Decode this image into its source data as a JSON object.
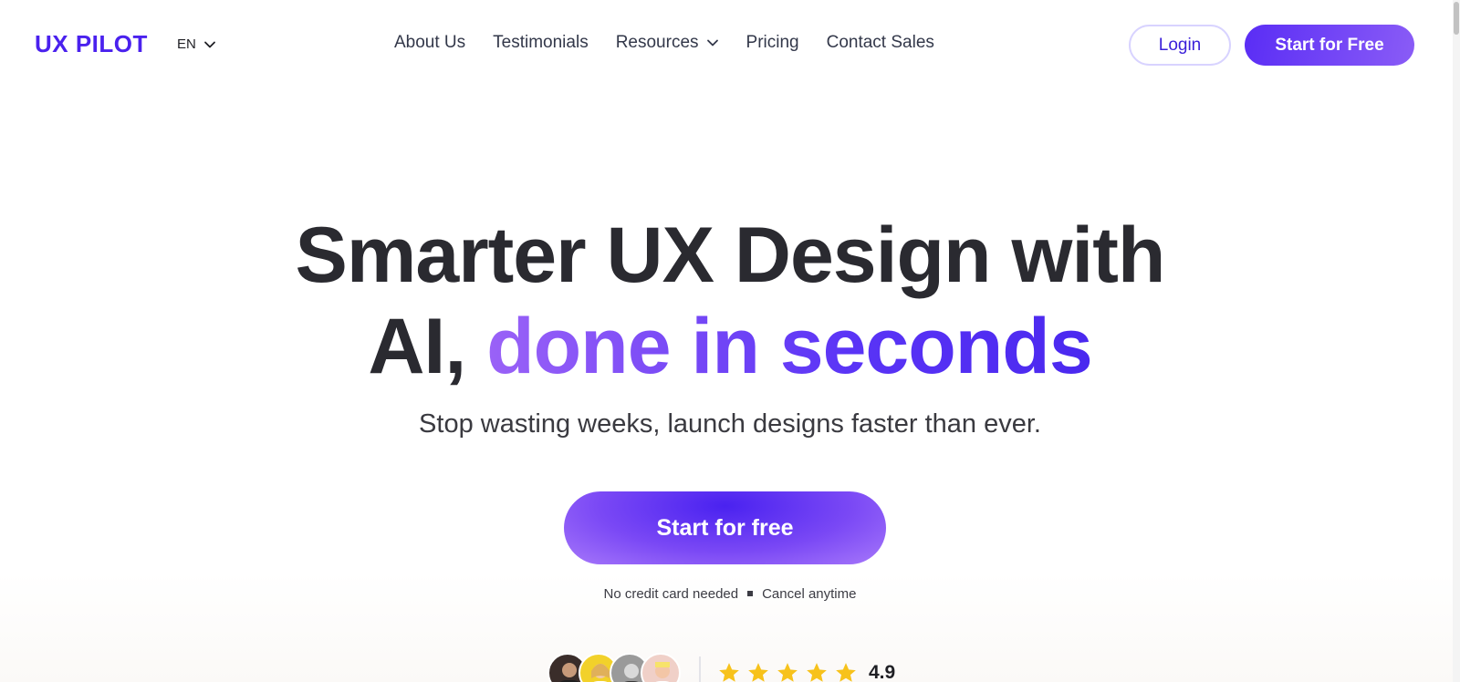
{
  "header": {
    "logo": "UX PILOT",
    "language": "EN",
    "nav": [
      {
        "label": "About Us",
        "dropdown": false
      },
      {
        "label": "Testimonials",
        "dropdown": false
      },
      {
        "label": "Resources",
        "dropdown": true
      },
      {
        "label": "Pricing",
        "dropdown": false
      },
      {
        "label": "Contact Sales",
        "dropdown": false
      }
    ],
    "login_label": "Login",
    "start_label": "Start for Free"
  },
  "hero": {
    "line1": "Smarter UX Design with",
    "line2_plain": "AI, ",
    "line2_accent": "done in seconds",
    "subtitle": "Stop wasting weeks, launch designs faster than ever.",
    "cta_label": "Start for free",
    "note_1": "No credit card needed",
    "note_2": "Cancel anytime"
  },
  "social_proof": {
    "avatars": [
      {
        "name": "user-avatar-1",
        "color": "#3a2d2a"
      },
      {
        "name": "user-avatar-2",
        "color": "#f2d12a"
      },
      {
        "name": "user-avatar-3",
        "color": "#9a9a9a"
      },
      {
        "name": "user-avatar-4",
        "color": "#f0d0c8"
      }
    ],
    "stars": 5,
    "rating": "4.9"
  },
  "colors": {
    "brand": "#4a21ee",
    "accent_gradient_start": "#9a62f7",
    "accent_gradient_end": "#4a28ef",
    "star": "#f7c21b"
  }
}
